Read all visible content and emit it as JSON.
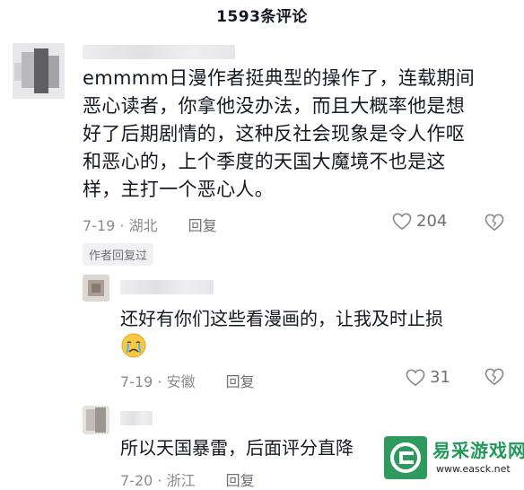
{
  "header": {
    "title": "1593条评论"
  },
  "main_comment": {
    "lines": [
      "emmmm日漫作者挺典型的操作了，连载期间",
      "恶心读者，你拿他没办法，而且大概率他是想",
      "好了后期剧情的，这种反社会现象是令人作呕",
      "和恶心的，上个季度的天国大魔境不也是这",
      "样，主打一个恶心人。"
    ],
    "date_location": "7-19 · 湖北",
    "reply_label": "回复",
    "like_count": "204",
    "author_tag": "作者回复过"
  },
  "replies": [
    {
      "text": "还好有你们这些看漫画的，让我及时止损",
      "date_location": "7-19 · 安徽",
      "reply_label": "回复",
      "like_count": "31",
      "emoji": "crying-face"
    },
    {
      "text": "所以天国暴雷，后面评分直降",
      "date_location": "7-20 · 浙江",
      "reply_label": "回复"
    }
  ],
  "watermark": {
    "title": "易采游戏网",
    "url": "www.easck.net"
  },
  "icons": {
    "like": "heart-outline-icon",
    "dislike": "broken-heart-icon"
  }
}
